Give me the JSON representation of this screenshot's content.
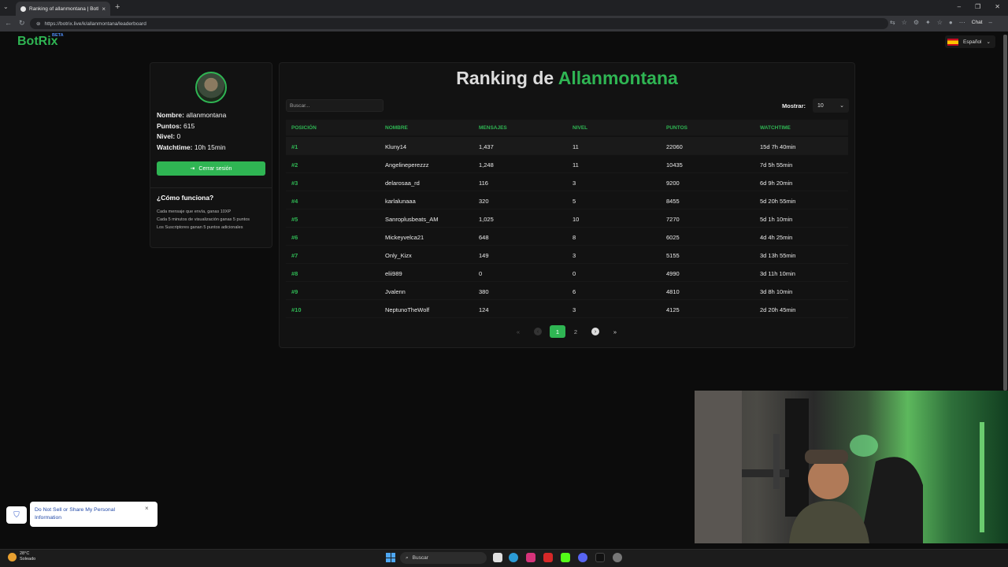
{
  "browser": {
    "tab_title": "Ranking of allanmontana | BotRix",
    "url": "https://botrix.live/k/allanmontana/leaderboard",
    "chat_label": "Chat"
  },
  "site": {
    "logo": "BotRix",
    "beta": "BETA",
    "language": "Español"
  },
  "profile": {
    "name_label": "Nombre:",
    "name": "allanmontana",
    "points_label": "Puntos:",
    "points": "615",
    "level_label": "Nivel:",
    "level": "0",
    "watch_label": "Watchtime:",
    "watchtime": "10h 15min",
    "logout": "Cerrar sesión",
    "how_title": "¿Cómo funciona?",
    "how_lines": [
      "Cada mensaje que envía, ganas 10XP",
      "Cada 5 minutos de visualización ganas 5 puntos",
      "Los Suscriptores ganan 5 puntos adicionales"
    ]
  },
  "ranking": {
    "title_prefix": "Ranking de",
    "title_name": "Allanmontana",
    "search_placeholder": "Buscar...",
    "show_label": "Mostrar:",
    "show_value": "10",
    "headers": [
      "POSICIÓN",
      "NOMBRE",
      "MENSAJES",
      "NIVEL",
      "PUNTOS",
      "WATCHTIME"
    ],
    "rows": [
      [
        "#1",
        "Kluny14",
        "1,437",
        "11",
        "22060",
        "15d 7h 40min"
      ],
      [
        "#2",
        "Angelineperezzz",
        "1,248",
        "11",
        "10435",
        "7d 5h 55min"
      ],
      [
        "#3",
        "delarosaa_rd",
        "116",
        "3",
        "9200",
        "6d 9h 20min"
      ],
      [
        "#4",
        "karlalunaaa",
        "320",
        "5",
        "8455",
        "5d 20h 55min"
      ],
      [
        "#5",
        "Sanroplusbeats_AM",
        "1,025",
        "10",
        "7270",
        "5d 1h 10min"
      ],
      [
        "#6",
        "Mickeyvelca21",
        "648",
        "8",
        "6025",
        "4d 4h 25min"
      ],
      [
        "#7",
        "Only_Kizx",
        "149",
        "3",
        "5155",
        "3d 13h 55min"
      ],
      [
        "#8",
        "elii989",
        "0",
        "0",
        "4990",
        "3d 11h 10min"
      ],
      [
        "#9",
        "Jvalenn",
        "380",
        "6",
        "4810",
        "3d 8h 10min"
      ],
      [
        "#10",
        "NeptunoTheWolf",
        "124",
        "3",
        "4125",
        "2d 20h 45min"
      ]
    ],
    "pages": [
      "1",
      "2"
    ],
    "current_page": "1"
  },
  "privacy": {
    "text": "Do Not Sell or Share My Personal Information"
  },
  "taskbar": {
    "temp": "28°C",
    "weather": "Soleado",
    "search": "Buscar"
  },
  "colors": {
    "accent": "#2fb553",
    "background": "#0c0c0c",
    "panel": "#121212"
  }
}
